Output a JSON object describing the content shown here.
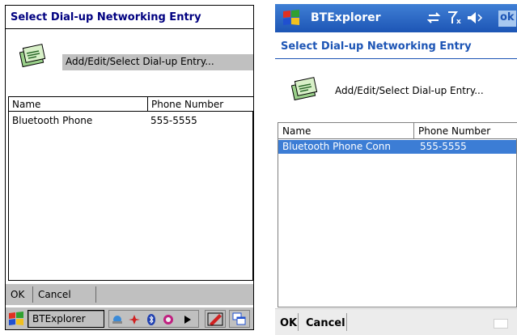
{
  "left": {
    "title": "Select Dial-up Networking Entry",
    "add_entry_label": "Add/Edit/Select Dial-up Entry...",
    "columns": [
      "Name",
      "Phone Number"
    ],
    "rows": [
      {
        "name": "Bluetooth Phone",
        "phone": "555-5555"
      }
    ],
    "menu": {
      "ok": "OK",
      "cancel": "Cancel"
    },
    "taskbar": {
      "app_label": "BTExplorer",
      "tray_icons": [
        "network-icon",
        "signal-icon",
        "bluetooth-icon",
        "sync-icon"
      ],
      "buttons": [
        "input-panel-icon",
        "windows-icon"
      ]
    }
  },
  "right": {
    "app_title": "BTExplorer",
    "status_icons": [
      "connectivity-icon",
      "antenna-icon",
      "volume-icon"
    ],
    "ok_button": "ok",
    "title": "Select Dial-up Networking Entry",
    "add_entry_label": "Add/Edit/Select Dial-up Entry...",
    "columns": [
      "Name",
      "Phone Number"
    ],
    "rows": [
      {
        "name": "Bluetooth Phone Conn",
        "phone": "555-5555",
        "selected": true
      }
    ],
    "menu": {
      "ok": "OK",
      "cancel": "Cancel"
    }
  },
  "colors": {
    "left_title": "#000080",
    "right_title": "#1d55b5",
    "nav_gradient_top": "#3f7fd5",
    "selection": "#3c7dd5"
  }
}
